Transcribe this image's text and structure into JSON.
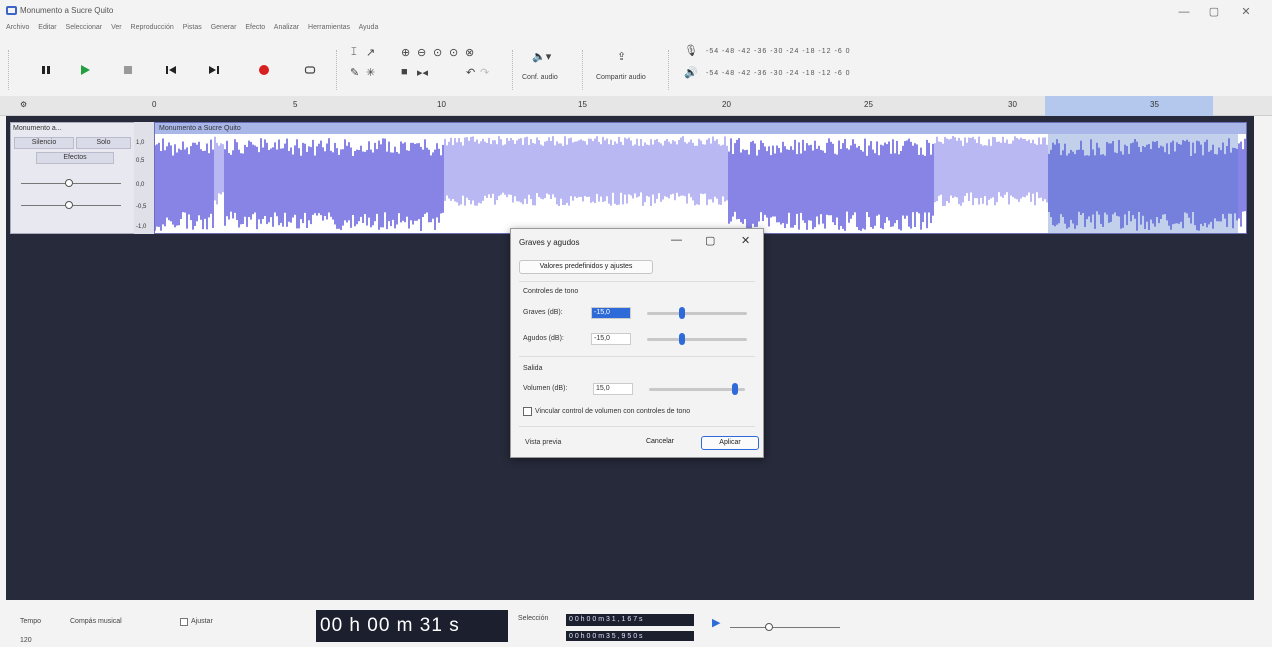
{
  "window": {
    "title": "Monumento a Sucre Quito",
    "minimize": "—",
    "maximize": "▢",
    "close": "✕"
  },
  "menu": [
    "Archivo",
    "Editar",
    "Seleccionar",
    "Ver",
    "Reproducción",
    "Pistas",
    "Generar",
    "Efecto",
    "Analizar",
    "Herramientas",
    "Ayuda"
  ],
  "toolbar": {
    "audio_config_label": "Conf. audio",
    "share_audio_label": "Compartir audio",
    "meter_scale_top": "-54 -48 -42 -36 -30 -24 -18 -12 -6 0",
    "meter_scale_bottom": "-54 -48 -42 -36 -30 -24 -18 -12 -6 0"
  },
  "ruler": {
    "ticks": [
      "0",
      "5",
      "10",
      "15",
      "20",
      "25",
      "30",
      "35"
    ]
  },
  "track": {
    "name": "Monumento a...",
    "mute_label": "Silencio",
    "solo_label": "Solo",
    "effects_label": "Efectos",
    "clip_name": "Monumento a Sucre Quito",
    "scale": [
      "1,0",
      "0,5",
      "0,0",
      "-0,5",
      "-1,0"
    ]
  },
  "dialog": {
    "title": "Graves y agudos",
    "presets_label": "Valores predefinidos y ajustes",
    "tone_controls_label": "Controles de tono",
    "bass_label": "Graves (dB):",
    "bass_value": "-15,0",
    "treble_label": "Agudos (dB):",
    "treble_value": "-15,0",
    "output_label": "Salida",
    "volume_label": "Volumen (dB):",
    "volume_value": "15,0",
    "link_label": "Vincular control de volumen con controles de tono",
    "preview_label": "Vista previa",
    "cancel_label": "Cancelar",
    "apply_label": "Aplicar",
    "bass_level": 0.35,
    "treble_level": 0.35,
    "volume_level": 0.9
  },
  "bottom": {
    "tempo_label": "Tempo",
    "tempo_value": "120",
    "time_signature_label": "Compás musical",
    "snap_label": "Ajustar",
    "time_display": "00 h 00 m 31 s",
    "selection_label": "Selección",
    "selection_start": "0 0 h 0 0 m 3 1 , 1 6 7 s",
    "selection_end": "0 0 h 0 0 m 3 5 , 9 5 0 s"
  },
  "colors": {
    "waveform": "#6b66e0",
    "waveform_light": "#a9a6ee",
    "selection": "#b4c8ee",
    "workspace": "#262a3a"
  }
}
